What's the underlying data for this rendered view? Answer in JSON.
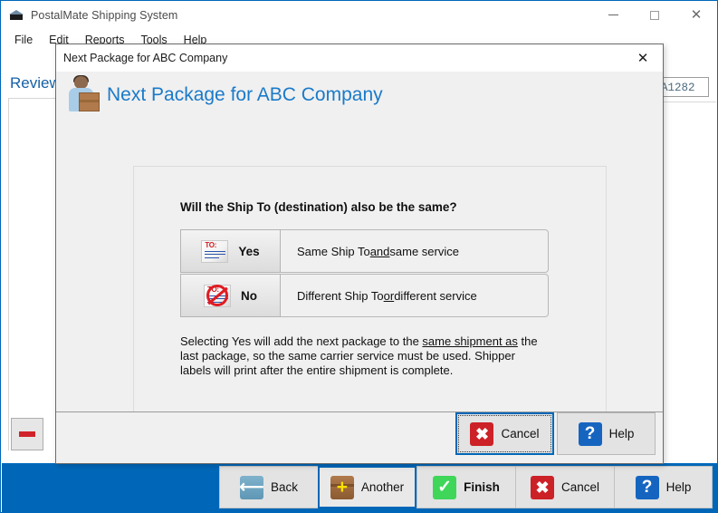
{
  "app": {
    "title": "PostalMate Shipping System",
    "icon": "package-icon",
    "menu": [
      "File",
      "Edit",
      "Reports",
      "Tools",
      "Help"
    ],
    "window_controls": {
      "minimize": "minimize-icon",
      "maximize": "maximize-icon",
      "close": "close-icon"
    },
    "background": {
      "review_label": "Review",
      "reference_field_value": "A1282",
      "minus_button_label": "remove-icon"
    }
  },
  "toolbar": {
    "buttons": [
      {
        "label": "Back",
        "icon": "back-arrow-icon",
        "state": "normal",
        "bold": false
      },
      {
        "label": "Another",
        "icon": "add-package-icon",
        "state": "hover",
        "bold": false
      },
      {
        "label": "Finish",
        "icon": "green-check-icon",
        "state": "normal",
        "bold": true
      },
      {
        "label": "Cancel",
        "icon": "red-x-icon",
        "state": "normal",
        "bold": false
      },
      {
        "label": "Help",
        "icon": "blue-question-icon",
        "state": "normal",
        "bold": false
      }
    ]
  },
  "dialog": {
    "titlebar_text": "Next Package for ABC Company",
    "close_label": "✕",
    "header_title": "Next Package for ABC Company",
    "header_icon": "shipper-person-with-box-icon",
    "question": "Will the Ship To (destination) also be the same?",
    "choices": [
      {
        "key": "yes",
        "label": "Yes",
        "icon": "shipping-label-icon",
        "description_before": "Same Ship To ",
        "description_underlined": "and",
        "description_after": " same service"
      },
      {
        "key": "no",
        "label": "No",
        "icon": "no-shipping-label-icon",
        "description_before": "Different Ship To ",
        "description_underlined": "or",
        "description_after": " different service"
      }
    ],
    "explanation": {
      "part1": "Selecting Yes will add the next package to the ",
      "underlined": "same shipment as",
      "part2": " the last package, so the same carrier service must be used.  Shipper labels will print after the entire shipment is complete."
    },
    "footer_buttons": [
      {
        "label": "Cancel",
        "icon": "red-x-icon",
        "focused": true
      },
      {
        "label": "Help",
        "icon": "blue-question-icon",
        "focused": false
      }
    ]
  },
  "colors": {
    "accent_blue": "#0067b8",
    "header_title_blue": "#1a7ac9",
    "cancel_red": "#cc2127",
    "finish_green": "#3fd65a",
    "help_blue": "#1565c0",
    "dialog_bg": "#f0f0f0"
  }
}
